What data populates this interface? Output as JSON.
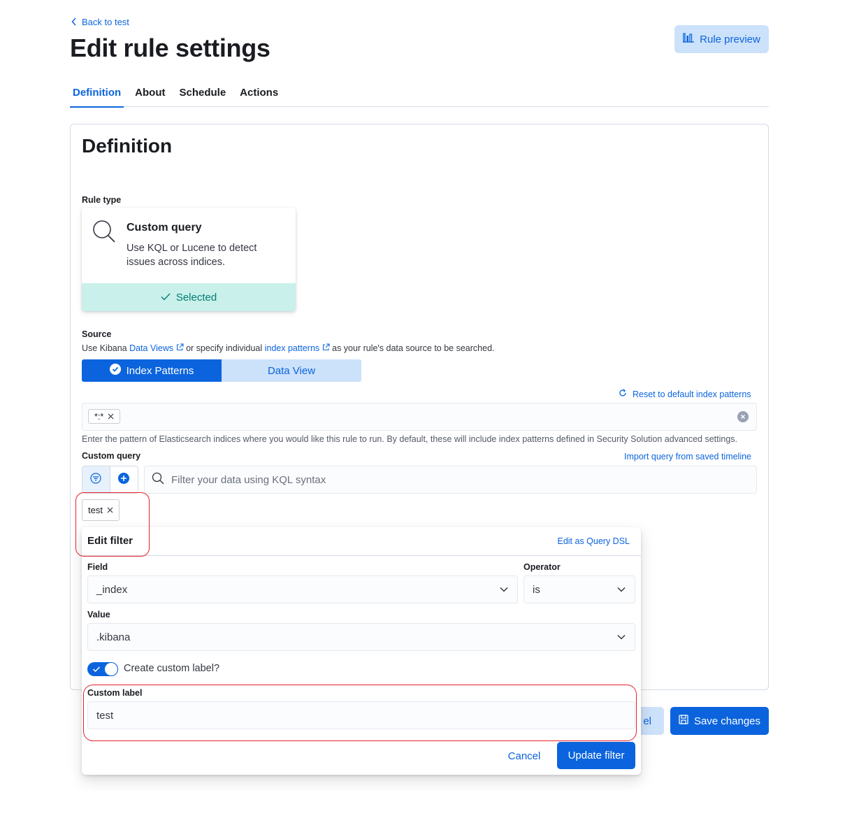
{
  "header": {
    "back_link": "Back to test",
    "title": "Edit rule settings",
    "rule_preview_label": "Rule preview"
  },
  "tabs": [
    {
      "label": "Definition",
      "active": true
    },
    {
      "label": "About",
      "active": false
    },
    {
      "label": "Schedule",
      "active": false
    },
    {
      "label": "Actions",
      "active": false
    }
  ],
  "definition": {
    "title": "Definition",
    "rule_type_label": "Rule type",
    "rule_card": {
      "title": "Custom query",
      "description": "Use KQL or Lucene to detect issues across indices.",
      "selected_label": "Selected",
      "icon": "search-icon"
    },
    "source": {
      "label": "Source",
      "help_prefix": "Use Kibana ",
      "data_views_link": "Data Views",
      "help_middle": " or specify individual ",
      "index_patterns_link": "index patterns",
      "help_suffix": " as your rule's data source to be searched.",
      "segment_index_patterns": "Index Patterns",
      "segment_data_view": "Data View",
      "reset_label": "Reset to default index patterns",
      "index_pattern_pills": [
        "*:*"
      ],
      "index_help": "Enter the pattern of Elasticsearch indices where you would like this rule to run. By default, these will include index patterns defined in Security Solution advanced settings."
    },
    "custom_query": {
      "label": "Custom query",
      "import_link": "Import query from saved timeline",
      "placeholder": "Filter your data using KQL syntax",
      "filter_pill": "test"
    }
  },
  "edit_filter": {
    "title": "Edit filter",
    "edit_dsl_link": "Edit as Query DSL",
    "field_label": "Field",
    "field_value": "_index",
    "operator_label": "Operator",
    "operator_value": "is",
    "value_label": "Value",
    "value_value": ".kibana",
    "custom_label_toggle": "Create custom label?",
    "custom_label_toggle_on": true,
    "custom_label_label": "Custom label",
    "custom_label_value": "test",
    "cancel_label": "Cancel",
    "update_label": "Update filter"
  },
  "footer": {
    "cancel_label_partial": "el",
    "save_label": "Save changes"
  },
  "colors": {
    "primary": "#0b64dd",
    "success_bg": "#c9f0ea",
    "highlight": "#e7212b"
  }
}
